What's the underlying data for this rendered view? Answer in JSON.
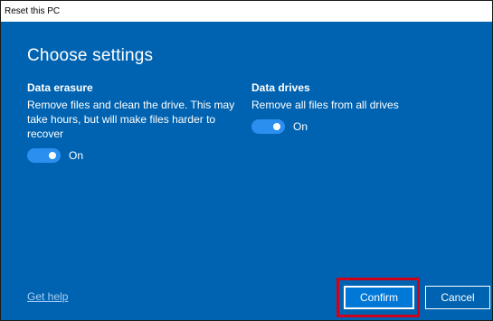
{
  "window": {
    "title": "Reset this PC"
  },
  "heading": "Choose settings",
  "data_erasure": {
    "title": "Data erasure",
    "description": "Remove files and clean the drive. This may take hours, but will make files harder to recover",
    "toggle_state": "On"
  },
  "data_drives": {
    "title": "Data drives",
    "description": "Remove all files from all drives",
    "toggle_state": "On"
  },
  "footer": {
    "help_link": "Get help",
    "confirm_label": "Confirm",
    "cancel_label": "Cancel"
  },
  "colors": {
    "background": "#0063b1",
    "toggle_on": "#2b8ff0",
    "highlight": "#d0021b"
  }
}
